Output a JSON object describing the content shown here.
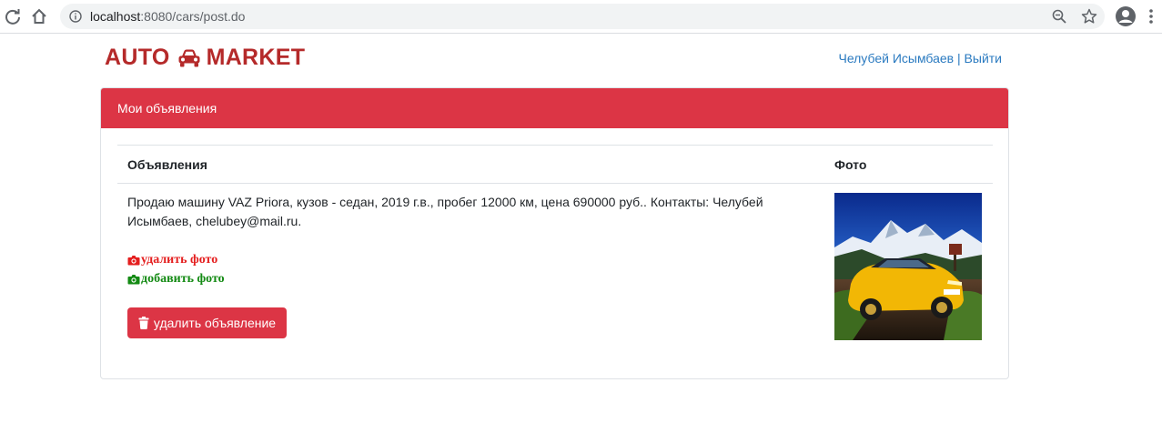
{
  "browser": {
    "url_host": "localhost",
    "url_path": ":8080/cars/post.do"
  },
  "header": {
    "brand_left": "AUTO",
    "brand_right": "MARKET",
    "user_name": "Челубей Исымбаев",
    "separator": "|",
    "logout": "Выйти"
  },
  "card": {
    "title": "Мои объявления",
    "columns": [
      "Объявления",
      "Фото"
    ],
    "ad": {
      "description": "Продаю машину VAZ Priora, кузов - седан, 2019 г.в., пробег 12000 км, цена 690000 руб.. Контакты: Челубей Исымбаев, chelubey@mail.ru.",
      "delete_photo": "удалить фото",
      "add_photo": "добавить фото",
      "delete_ad": "удалить объявление"
    }
  },
  "colors": {
    "brand": "#b52a2a",
    "danger": "#dc3545",
    "link": "#2a7ac0",
    "delete_photo": "#e41e1e",
    "add_photo": "#138a13"
  }
}
